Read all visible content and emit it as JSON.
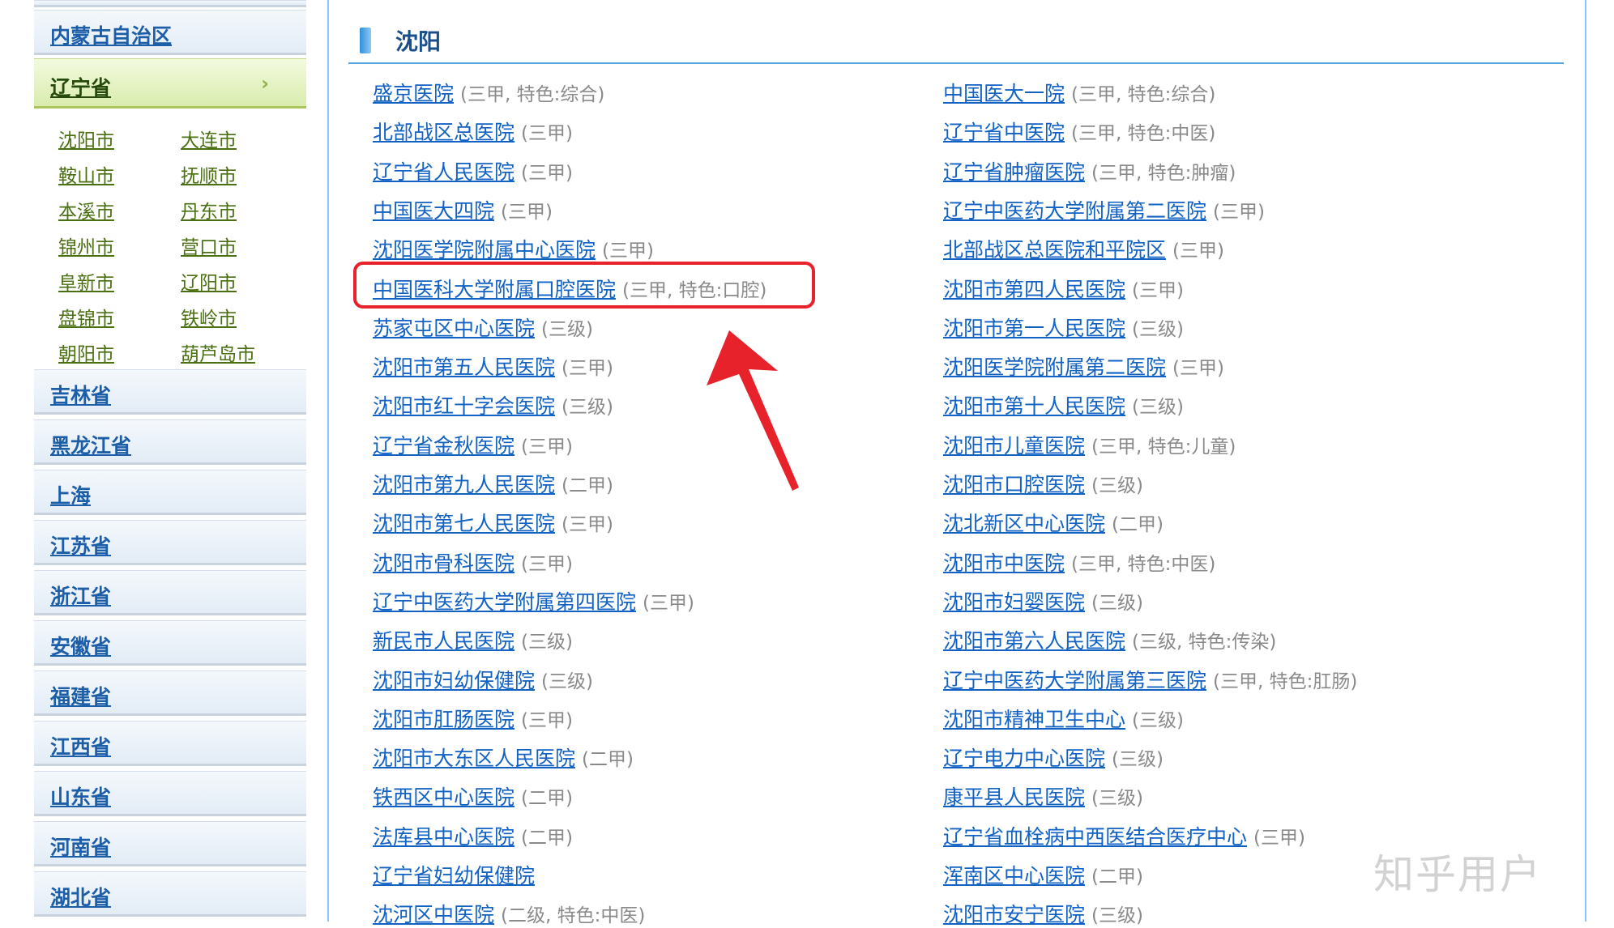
{
  "sidebar": {
    "provinces_top": [
      {
        "label": "内蒙古自治区"
      },
      {
        "label": "辽宁省"
      }
    ],
    "cities": [
      "沈阳市",
      "大连市",
      "鞍山市",
      "抚顺市",
      "本溪市",
      "丹东市",
      "锦州市",
      "营口市",
      "阜新市",
      "辽阳市",
      "盘锦市",
      "铁岭市",
      "朝阳市",
      "葫芦岛市"
    ],
    "provinces_bottom": [
      "吉林省",
      "黑龙江省",
      "上海",
      "江苏省",
      "浙江省",
      "安徽省",
      "福建省",
      "江西省",
      "山东省",
      "河南省",
      "湖北省"
    ]
  },
  "section": {
    "title": "沈阳"
  },
  "hospitals_left": [
    {
      "name": "盛京医院",
      "meta": "(三甲, 特色:综合)"
    },
    {
      "name": "北部战区总医院",
      "meta": "(三甲)"
    },
    {
      "name": "辽宁省人民医院",
      "meta": "(三甲)"
    },
    {
      "name": "中国医大四院",
      "meta": "(三甲)"
    },
    {
      "name": "沈阳医学院附属中心医院",
      "meta": "(三甲)"
    },
    {
      "name": "中国医科大学附属口腔医院",
      "meta": "(三甲, 特色:口腔)"
    },
    {
      "name": "苏家屯区中心医院",
      "meta": "(三级)"
    },
    {
      "name": "沈阳市第五人民医院",
      "meta": "(三甲)"
    },
    {
      "name": "沈阳市红十字会医院",
      "meta": "(三级)"
    },
    {
      "name": "辽宁省金秋医院",
      "meta": "(三甲)"
    },
    {
      "name": "沈阳市第九人民医院",
      "meta": "(二甲)"
    },
    {
      "name": "沈阳市第七人民医院",
      "meta": "(三甲)"
    },
    {
      "name": "沈阳市骨科医院",
      "meta": "(三甲)"
    },
    {
      "name": "辽宁中医药大学附属第四医院",
      "meta": "(三甲)"
    },
    {
      "name": "新民市人民医院",
      "meta": "(三级)"
    },
    {
      "name": "沈阳市妇幼保健院",
      "meta": "(三级)"
    },
    {
      "name": "沈阳市肛肠医院",
      "meta": "(三甲)"
    },
    {
      "name": "沈阳市大东区人民医院",
      "meta": "(二甲)"
    },
    {
      "name": "铁西区中心医院",
      "meta": "(二甲)"
    },
    {
      "name": "法库县中心医院",
      "meta": "(二甲)"
    },
    {
      "name": "辽宁省妇幼保健院",
      "meta": ""
    },
    {
      "name": "沈河区中医院",
      "meta": "(二级, 特色:中医)"
    }
  ],
  "hospitals_right": [
    {
      "name": "中国医大一院",
      "meta": "(三甲, 特色:综合)"
    },
    {
      "name": "辽宁省中医院",
      "meta": "(三甲, 特色:中医)"
    },
    {
      "name": "辽宁省肿瘤医院",
      "meta": "(三甲, 特色:肿瘤)"
    },
    {
      "name": "辽宁中医药大学附属第二医院",
      "meta": "(三甲)"
    },
    {
      "name": "北部战区总医院和平院区",
      "meta": "(三甲)"
    },
    {
      "name": "沈阳市第四人民医院",
      "meta": "(三甲)"
    },
    {
      "name": "沈阳市第一人民医院",
      "meta": "(三级)"
    },
    {
      "name": "沈阳医学院附属第二医院",
      "meta": "(三甲)"
    },
    {
      "name": "沈阳市第十人民医院",
      "meta": "(三级)"
    },
    {
      "name": "沈阳市儿童医院",
      "meta": "(三甲, 特色:儿童)"
    },
    {
      "name": "沈阳市口腔医院",
      "meta": "(三级)"
    },
    {
      "name": "沈北新区中心医院",
      "meta": "(二甲)"
    },
    {
      "name": "沈阳市中医院",
      "meta": "(三甲, 特色:中医)"
    },
    {
      "name": "沈阳市妇婴医院",
      "meta": "(三级)"
    },
    {
      "name": "沈阳市第六人民医院",
      "meta": "(三级, 特色:传染)"
    },
    {
      "name": "辽宁中医药大学附属第三医院",
      "meta": "(三甲, 特色:肛肠)"
    },
    {
      "name": "沈阳市精神卫生中心",
      "meta": "(三级)"
    },
    {
      "name": "辽宁电力中心医院",
      "meta": "(三级)"
    },
    {
      "name": "康平县人民医院",
      "meta": "(三级)"
    },
    {
      "name": "辽宁省血栓病中西医结合医疗中心",
      "meta": "(三甲)"
    },
    {
      "name": "浑南区中心医院",
      "meta": "(二甲)"
    },
    {
      "name": "沈阳市安宁医院",
      "meta": "(三级)"
    }
  ],
  "annotation": {
    "highlight_color": "#e8222a",
    "arrow_icon": "red-arrow-icon"
  },
  "watermark": "知乎用户"
}
